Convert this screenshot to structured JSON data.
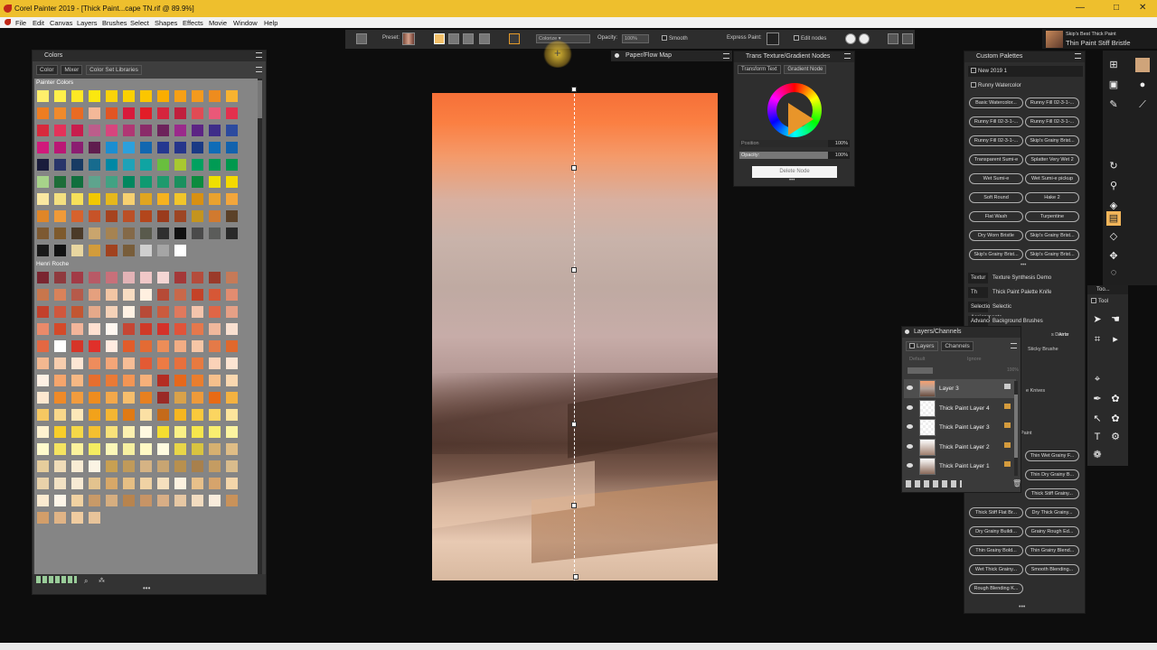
{
  "app": {
    "title": "Corel Painter 2019 - [Thick Paint...cape TN.rif @ 89.9%]"
  },
  "menu": [
    "File",
    "Edit",
    "Canvas",
    "Layers",
    "Brushes",
    "Select",
    "Shapes",
    "Effects",
    "Movie",
    "Window",
    "Help"
  ],
  "window_controls": {
    "minimize": "—",
    "maximize": "□",
    "close": "✕"
  },
  "propbar": {
    "preset_label": "Preset:",
    "mode_value": "Colorize",
    "opacity_label": "Opacity:",
    "opacity_value": "100%",
    "smooth_label": "Smooth",
    "express_label": "Express Paint:",
    "edit_nodes_label": "Edit nodes"
  },
  "brush": {
    "category": "Skip's Best Thick Paint",
    "variant": "Thin Paint Stiff Bristle"
  },
  "colors_panel": {
    "title": "Colors",
    "tabs": [
      "Color",
      "Mixer",
      "Color Set Libraries"
    ],
    "section1": "Painter Colors",
    "section2": "Henri Roche"
  },
  "palette1": [
    "#ffef6b",
    "#fff04a",
    "#fde825",
    "#fbe70f",
    "#fbd30a",
    "#fbd100",
    "#fbc600",
    "#fbad00",
    "#f7a016",
    "#f39a1d",
    "#ee8c1e",
    "#f8b330",
    "#ee7d21",
    "#f08a2b",
    "#ea6b23",
    "#f4b898",
    "#e25523",
    "#d81a3b",
    "#e21d27",
    "#d6253d",
    "#c11f3d",
    "#e14b54",
    "#ea5878",
    "#e3304d",
    "#d72a3c",
    "#e4325a",
    "#c81d4d",
    "#bc5d8b",
    "#d7457e",
    "#b03774",
    "#8a2b69",
    "#6d225b",
    "#9a2a8b",
    "#5c2484",
    "#3e2d89",
    "#2c4a9e",
    "#d01a7b",
    "#ba1775",
    "#8b1e71",
    "#5f1d4e",
    "#1b8ed1",
    "#2ca0dc",
    "#1267b0",
    "#253890",
    "#26358b",
    "#1a3a85",
    "#0f6cb7",
    "#1262ad",
    "#1a1c3c",
    "#29356a",
    "#183b63",
    "#176b8e",
    "#0088a5",
    "#1fa2b8",
    "#0fa4a2",
    "#69bf3e",
    "#a8c830",
    "#00a160",
    "#009b54",
    "#00984d",
    "#a7d38a",
    "#1d6d38",
    "#116f3e",
    "#5ea48d",
    "#41a283",
    "#00875f",
    "#0f9a71",
    "#1f9a6d",
    "#1a905e",
    "#0c8b3e",
    "#eee000",
    "#f5d900",
    "#f9e7a1",
    "#f4e080",
    "#f6e05a",
    "#f1c800",
    "#e6b81c",
    "#f6d070",
    "#e0a520",
    "#f6b21f",
    "#f1c52a",
    "#d89012",
    "#e9a22e",
    "#f3a63b",
    "#e08627",
    "#f09a38",
    "#d7622d",
    "#c75328",
    "#a6431f",
    "#bb5027",
    "#b3461c",
    "#9a3b1c",
    "#9d4624",
    "#c4941e",
    "#d17a2f",
    "#5b4128",
    "#7d5931",
    "#7e5a2c",
    "#4b3a28",
    "#c9a56d",
    "#a68352",
    "#846948",
    "#595a4c",
    "#2f2f2f",
    "#101010",
    "#4a4a4a",
    "#5b5c5a",
    "#292929",
    "#191919",
    "#121212",
    "#e8d6a0",
    "#d29c3b",
    "#a1421f",
    "#785d3a",
    "#cfcfcf",
    "#a5a5a5",
    "#ffffff"
  ],
  "palette2": [
    "#7a2530",
    "#8f3a3e",
    "#a23b46",
    "#b85a66",
    "#c8707a",
    "#e2b3b6",
    "#f0c8c8",
    "#f4d6d4",
    "#a43838",
    "#b44c3c",
    "#9a3a2a",
    "#c67a58",
    "#c8764c",
    "#d9825a",
    "#b65a4a",
    "#e5a07e",
    "#f2c6a4",
    "#f7dcc2",
    "#fff0e0",
    "#b64a36",
    "#c9684a",
    "#c44228",
    "#d65736",
    "#e28c70",
    "#c2402b",
    "#d0573d",
    "#c25632",
    "#e5a98a",
    "#f5d2b8",
    "#fff1e4",
    "#b84a37",
    "#cb5b3e",
    "#e0795d",
    "#f4c4ac",
    "#e06646",
    "#e6a086",
    "#ea8a6a",
    "#d44a2a",
    "#f3b59a",
    "#ffe0d0",
    "#fff7f0",
    "#c54634",
    "#cf3a28",
    "#d4322a",
    "#e0543a",
    "#e5784c",
    "#f0b89c",
    "#f9e0d0",
    "#e36842",
    "#ffffff",
    "#d63528",
    "#e0302a",
    "#ffebe0",
    "#e15c2a",
    "#e36b34",
    "#ed8d58",
    "#f2ad84",
    "#f6c6a6",
    "#e47a48",
    "#e0682c",
    "#f3b890",
    "#f7cdae",
    "#fde6d4",
    "#ee8c5c",
    "#f4a678",
    "#f7bd96",
    "#e35a34",
    "#ed7b44",
    "#e8703c",
    "#e87a40",
    "#fad2b8",
    "#fce4d2",
    "#fdf0e4",
    "#f5a56c",
    "#f6b884",
    "#e76e2e",
    "#ea7a36",
    "#f49554",
    "#f6b07a",
    "#b42d22",
    "#e6681c",
    "#ea7e2e",
    "#f6c08c",
    "#fad8b0",
    "#fde8d0",
    "#ef8a28",
    "#f29c3e",
    "#ee8c1e",
    "#f3a84a",
    "#f6be6c",
    "#e78020",
    "#9a2a26",
    "#d9a24a",
    "#ee9a3a",
    "#e86a14",
    "#f4b240",
    "#f6c862",
    "#f9d88a",
    "#fce8b8",
    "#f2a21a",
    "#f5b632",
    "#e07a14",
    "#fbe0a4",
    "#c46a1a",
    "#f6b620",
    "#f9c93c",
    "#fbd560",
    "#fde59c",
    "#fff2d0",
    "#f8ce2a",
    "#f5d848",
    "#f5c030",
    "#f9e27a",
    "#fcf0b0",
    "#fff9e0",
    "#f4dd30",
    "#faf086",
    "#f6e64c",
    "#f9ee70",
    "#fcf4a0",
    "#fffacc",
    "#f5e460",
    "#fbf29c",
    "#f4ec60",
    "#fbf7b8",
    "#f6f0a0",
    "#fff9c4",
    "#fffbe0",
    "#e9d648",
    "#d8c440",
    "#d6b070",
    "#dfbd86",
    "#e6cd9c",
    "#efdcb8",
    "#f8ecd4",
    "#fbf4e4",
    "#c8a052",
    "#c09a5a",
    "#d5b384",
    "#c8a572",
    "#b8904e",
    "#a8804c",
    "#c49c62",
    "#d9bc8c",
    "#e9d2aa",
    "#f2e2c4",
    "#f7ead4",
    "#e3c38e",
    "#d8a868",
    "#e6bf84",
    "#f0d2a4",
    "#f6e0be",
    "#fdf2e0",
    "#e8c08a",
    "#d6a46c",
    "#f4d6aa",
    "#faead0",
    "#fdf5e8",
    "#f1d2a2",
    "#c89a68",
    "#d6ae80",
    "#b8844e",
    "#c79466",
    "#d8ae86",
    "#e7c8a4",
    "#f2dcc0",
    "#f9ecdc",
    "#c9925a",
    "#d29e6a",
    "#e0b486",
    "#f0cca0",
    "#e8c49a"
  ],
  "paper_panel": {
    "title": "Paper/Flow Map"
  },
  "trans_panel": {
    "title": "Trans Texture/Gradient Nodes",
    "tab1": "Transform Text",
    "tab2": "Gradient Node",
    "position_label": "Position",
    "position_value": "100%",
    "opacity_label": "Opacity:",
    "opacity_value": "100%",
    "delete_label": "Delete Node"
  },
  "custom_palettes": {
    "title": "Custom Palettes",
    "sel1": "New 2019 1",
    "sel2": "Runny Watercolor",
    "buttons": [
      [
        "Basic Watercolor...",
        "Runny Fill 02-3-1-..."
      ],
      [
        "Runny Fill 02-3-1-...",
        "Runny Fill 02-3-1-..."
      ],
      [
        "Runny Fill 02-3-1-...",
        "Skip's Grainy Brist..."
      ],
      [
        "Transparent Sumi-e",
        "Splatter Very Wet 2"
      ],
      [
        "Wet Sumi-e",
        "Wet Sumi-e pickup"
      ],
      [
        "Soft Round",
        "Hake 2"
      ],
      [
        "Flat Wash",
        "Turpentine"
      ],
      [
        "Dry Worn Bristle",
        "Skip's Grainy Brist..."
      ],
      [
        "Skip's Grainy Brist...",
        "Skip's Grainy Brist..."
      ]
    ],
    "rows": [
      "Textur",
      "Texture Synthesis Demo",
      "Th",
      "Thick Paint Palette Knife",
      "Selection Assignments",
      "Selectic",
      "Advancec",
      "Background Brushes"
    ],
    "lower_buttons": [
      [
        "",
        "Thin Wet Grainy F..."
      ],
      [
        "",
        "Thin Dry Grainy B..."
      ],
      [
        "",
        "Thick Stiff Grainy..."
      ],
      [
        "Thick Stiff Flat Br...",
        "Dry Thick Grainy..."
      ],
      [
        "Dry Grainy Buildi...",
        "Grainy Rough Ed..."
      ],
      [
        "Thin Grainy Bold...",
        "Thin Grainy Blend..."
      ],
      [
        "Wet Thick Grainy...",
        "Smooth Blending..."
      ],
      [
        "Rough Blending K...",
        ""
      ]
    ],
    "partial": [
      "s Demo",
      "Airbr",
      "Sticky Brushe",
      "e Knives",
      "Paint"
    ]
  },
  "toolbox_small": {
    "title": "Too...",
    "tab": "Tool"
  },
  "layers_panel": {
    "title": "Layers/Channels",
    "tab1": "Layers",
    "tab2": "Channels",
    "composite": "Default",
    "ignore": "Ignore",
    "opacity": "100%",
    "layers": [
      "Layer 3",
      "Thick Paint Layer 4",
      "Thick Paint Layer 3",
      "Thick Paint Layer 2",
      "Thick Paint Layer 1"
    ]
  },
  "more": "•••"
}
